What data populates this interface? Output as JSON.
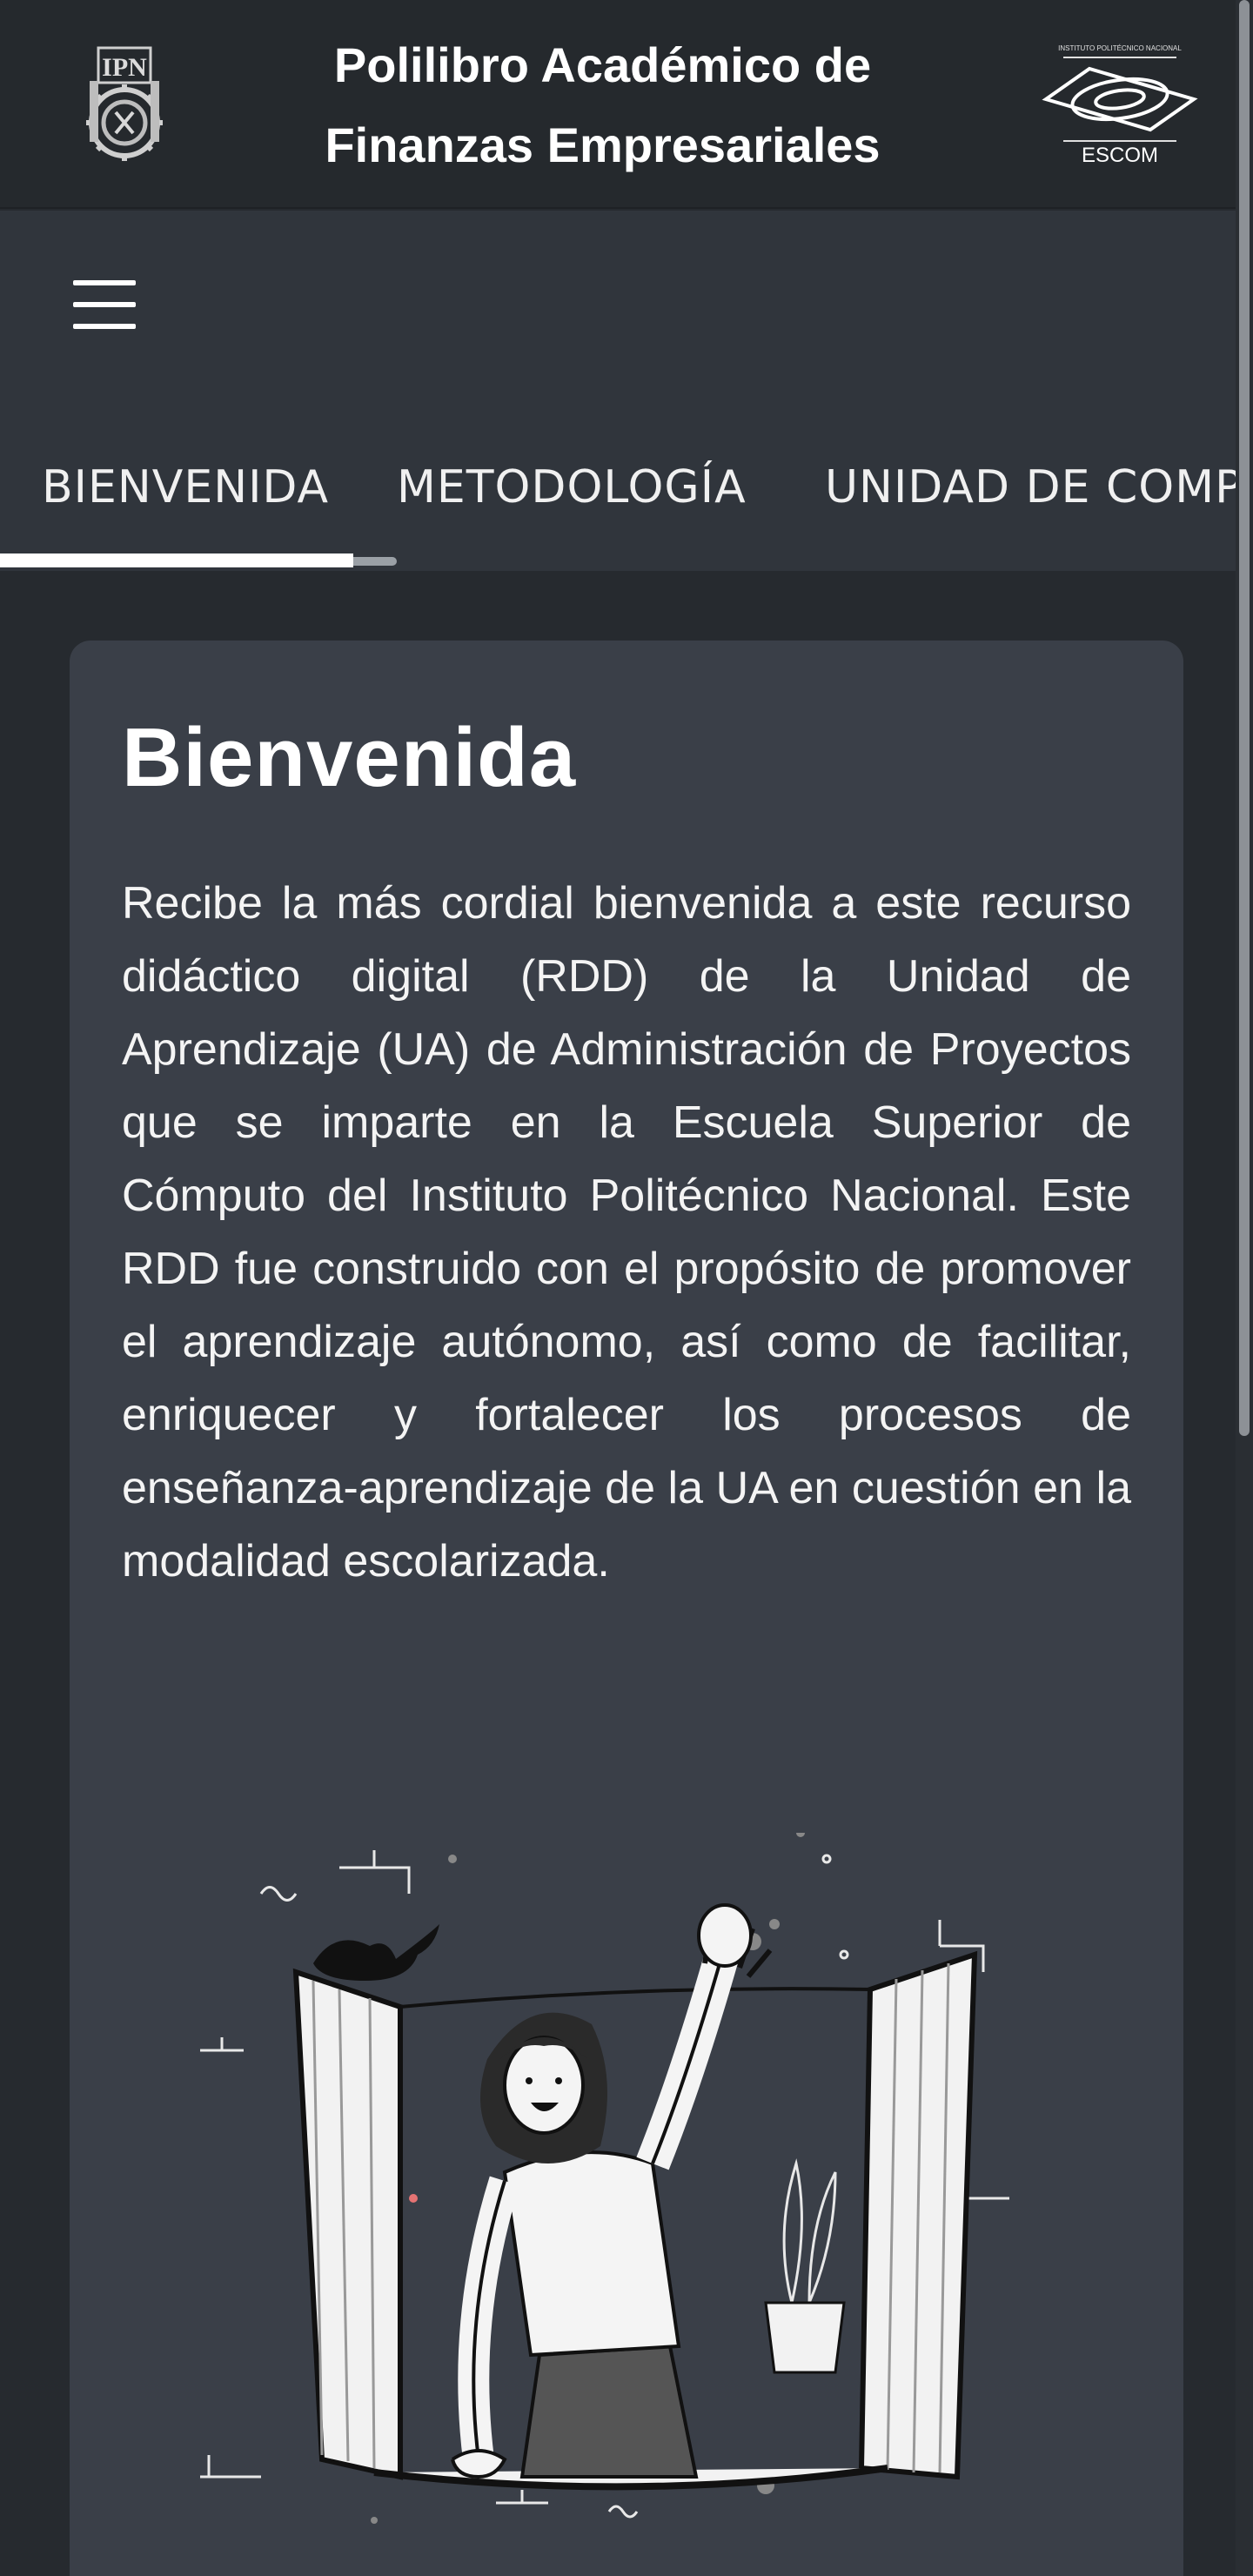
{
  "header": {
    "title_line1": "Polilibro Académico de",
    "title_line2": "Finanzas Empresariales",
    "left_logo_text": "IPN",
    "right_logo_caption": "ESCOM",
    "right_logo_small_text": "INSTITUTO POLITÉCNICO NACIONAL"
  },
  "toolbar": {
    "menu_icon": "hamburger-menu-icon"
  },
  "tabs": [
    {
      "label": "BIENVENIDA",
      "active": true
    },
    {
      "label": "METODOLOGÍA",
      "active": false
    },
    {
      "label": "UNIDAD DE COMPETENCIA",
      "active": false
    }
  ],
  "card": {
    "title": "Bienvenida",
    "body": "Recibe la más cordial bienvenida a este recurso didáctico digital (RDD) de la Unidad de Aprendizaje (UA) de Administración de Proyectos que se imparte en la Escuela Superior de Cómputo del Instituto Politécnico Nacional. Este RDD fue construido con el propósito de promover el aprendizaje autónomo, así como de facilitar, enriquecer y fortalecer los procesos de enseñanza-aprendizaje de la UA en cuestión en la modalidad escolarizada."
  },
  "colors": {
    "header_bg": "#25292d",
    "toolbar_bg": "#30353c",
    "page_bg": "#262a2f",
    "card_bg": "#3a3f48",
    "text": "#ffffff"
  }
}
